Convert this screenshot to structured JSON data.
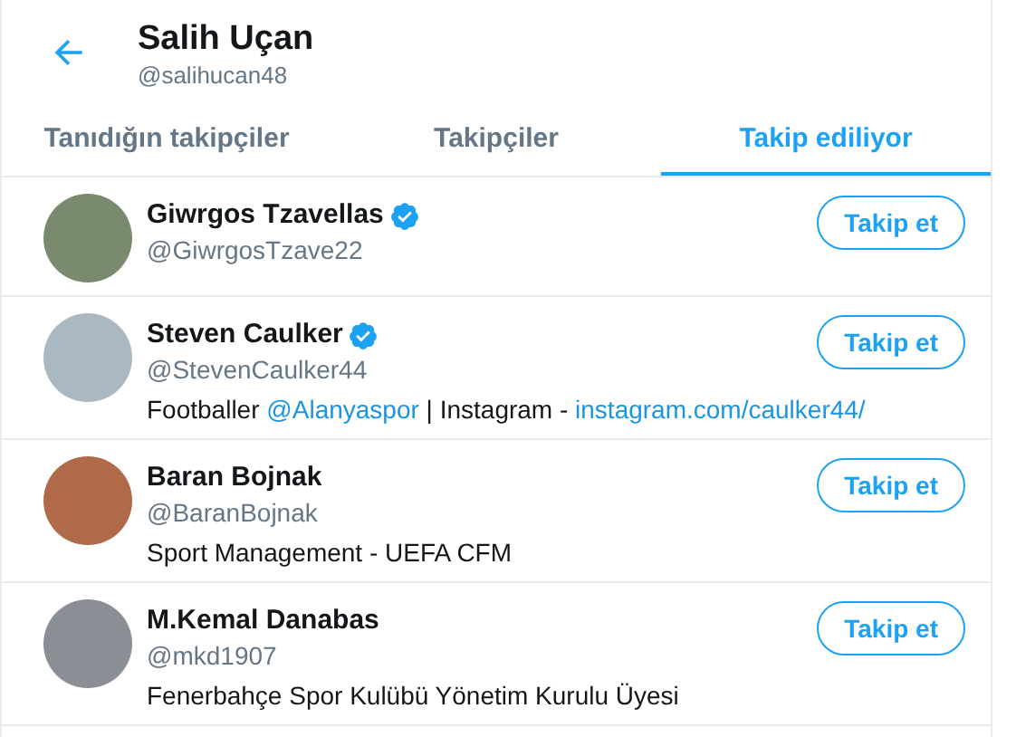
{
  "header": {
    "name": "Salih Uçan",
    "handle": "@salihucan48"
  },
  "tabs": [
    {
      "label": "Tanıdığın takipçiler",
      "selected": false
    },
    {
      "label": "Takipçiler",
      "selected": false
    },
    {
      "label": "Takip ediliyor",
      "selected": true
    }
  ],
  "users": [
    {
      "name": "Giwrgos Tzavellas",
      "verified": true,
      "handle": "@GiwrgosTzave22",
      "button": "Takip et"
    },
    {
      "name": "Steven Caulker",
      "verified": true,
      "handle": "@StevenCaulker44",
      "bio": [
        {
          "kind": "text",
          "text": "Footballer "
        },
        {
          "kind": "link",
          "text": "@Alanyaspor"
        },
        {
          "kind": "text",
          "text": " | Instagram - "
        },
        {
          "kind": "link",
          "text": "instagram.com/caulker44/"
        }
      ],
      "button": "Takip et"
    },
    {
      "name": "Baran Bojnak",
      "verified": false,
      "handle": "@BaranBojnak",
      "bio": [
        {
          "kind": "text",
          "text": "Sport Management - UEFA CFM"
        }
      ],
      "button": "Takip et"
    },
    {
      "name": "M.Kemal Danabas",
      "verified": false,
      "handle": "@mkd1907",
      "bio": [
        {
          "kind": "text",
          "text": "Fenerbahçe Spor Kulübü Yönetim Kurulu Üyesi"
        }
      ],
      "button": "Takip et"
    }
  ]
}
